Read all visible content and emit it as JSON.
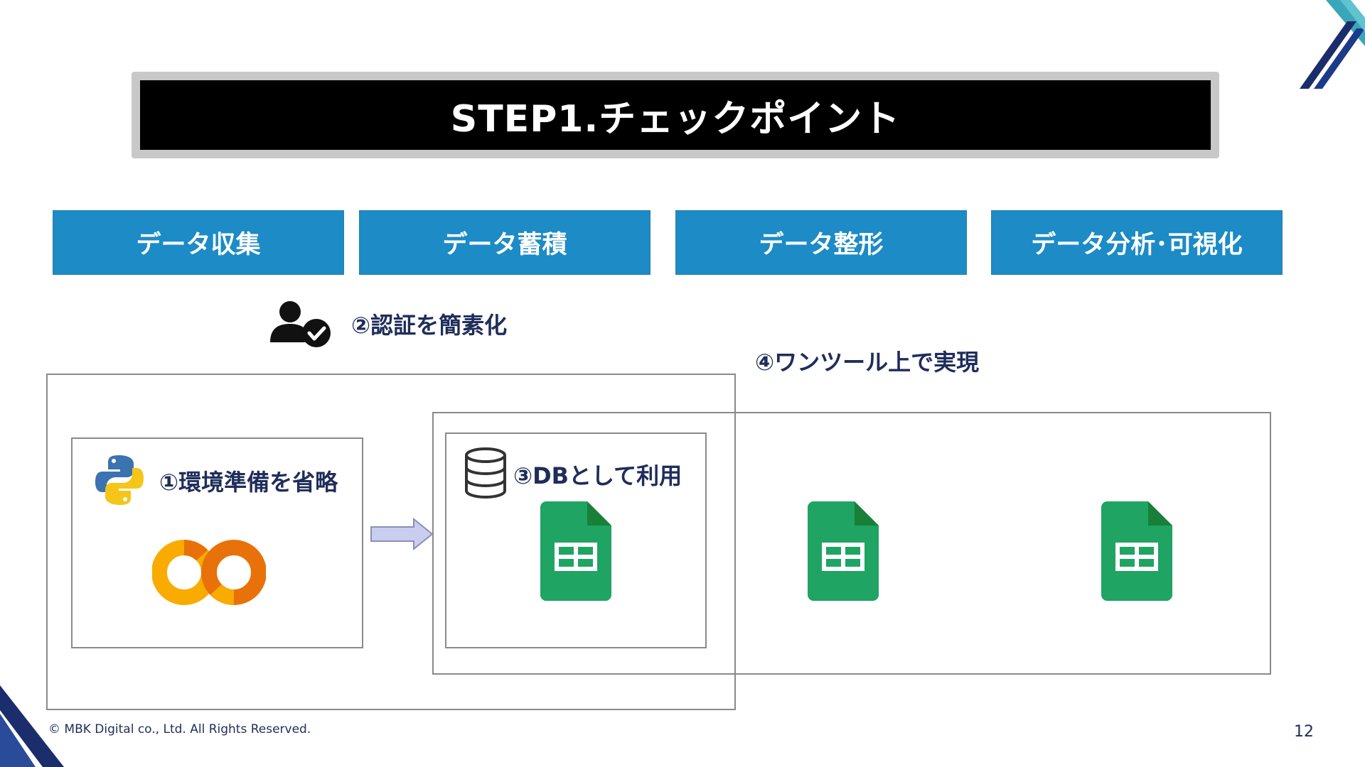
{
  "title": "STEP1.チェックポイント",
  "steps": [
    {
      "label": "データ収集"
    },
    {
      "label": "データ蓄積"
    },
    {
      "label": "データ整形"
    },
    {
      "label": "データ分析･可視化"
    }
  ],
  "points": {
    "p1": "①環境準備を省略",
    "p2": "②認証を簡素化",
    "p3": "③DBとして利用",
    "p4": "④ワンツール上で実現"
  },
  "icons": {
    "auth": "user-check-icon",
    "python": "python-logo-icon",
    "colab": "colab-logo-icon",
    "database": "database-icon",
    "arrow": "right-arrow-icon",
    "sheets": "google-sheets-icon"
  },
  "colors": {
    "step_blue": "#1c8bc6",
    "label_navy": "#1f2d5a",
    "sheets_green": "#1fa463",
    "colab_orange": "#f9ab00"
  },
  "footer": {
    "copyright": "© MBK Digital co., Ltd. All Rights Reserved.",
    "page_number": "12"
  }
}
